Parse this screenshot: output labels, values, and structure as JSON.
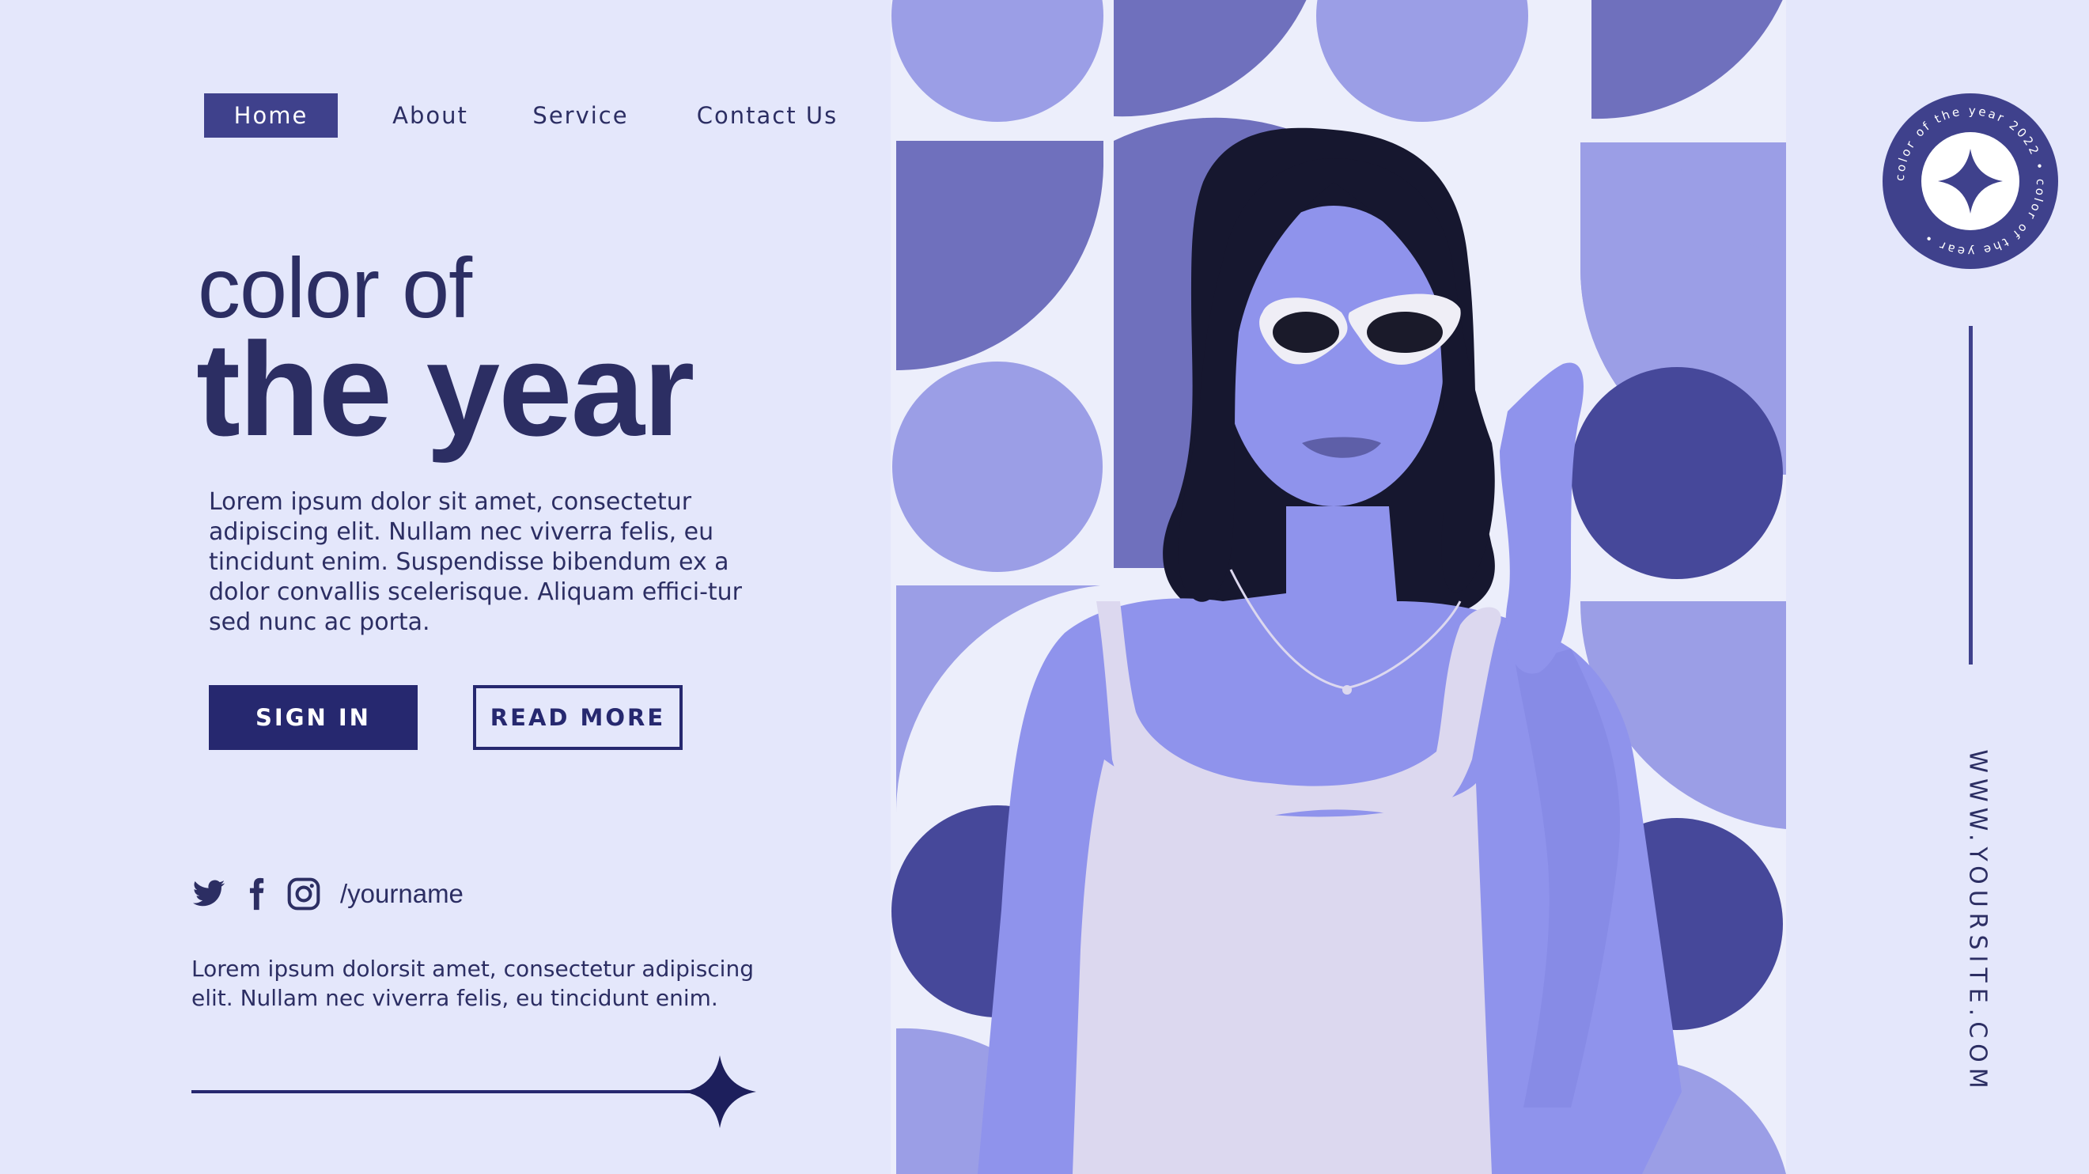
{
  "nav": {
    "items": [
      {
        "label": "Home",
        "active": true
      },
      {
        "label": "About",
        "active": false
      },
      {
        "label": "Service",
        "active": false
      },
      {
        "label": "Contact Us",
        "active": false
      }
    ]
  },
  "hero": {
    "line1": "color of",
    "line2": "the year",
    "body": "Lorem ipsum dolor sit amet, consectetur adipiscing elit. Nullam nec viverra felis, eu tincidunt enim. Suspendisse bibendum ex a dolor convallis scelerisque. Aliquam effici-tur sed nunc ac porta."
  },
  "buttons": {
    "sign_in": "SIGN IN",
    "read_more": "READ MORE"
  },
  "social": {
    "icons": [
      "twitter-icon",
      "facebook-icon",
      "instagram-icon"
    ],
    "handle": "/yourname"
  },
  "footer": {
    "text": "Lorem ipsum dolorsit amet, consectetur adipiscing elit. Nullam nec viverra felis, eu tincidunt enim."
  },
  "badge": {
    "circular_text": "color of the year 2022 • color of the year •"
  },
  "site_url": "WWW.YOURSITE.COM",
  "colors": {
    "background": "#e4e7fb",
    "navy": "#2c2e63",
    "accent_dark": "#26286f",
    "pattern_light": "#9b9ee6",
    "pattern_mid": "#6f70bd",
    "pattern_dark": "#46489a",
    "photo_tint": "#8f93ec"
  }
}
